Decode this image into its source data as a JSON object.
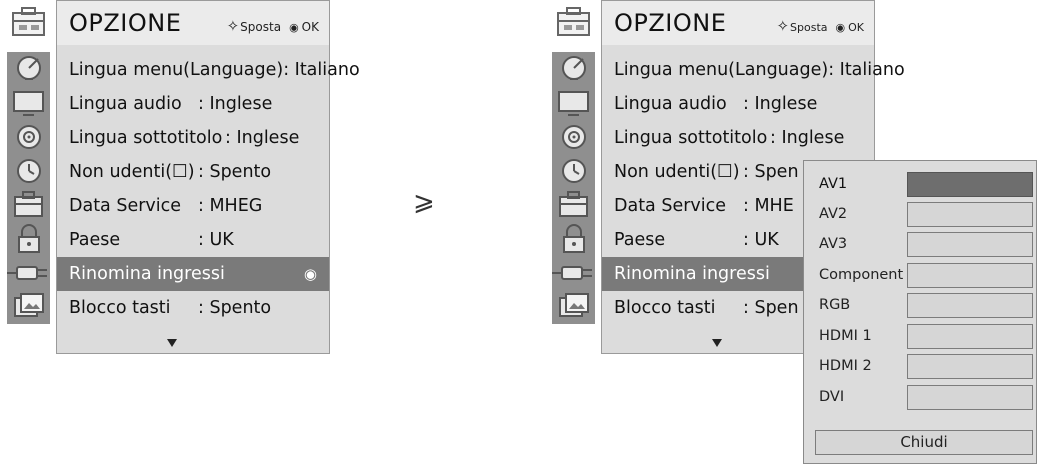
{
  "panel_left": {
    "title": "OPZIONE",
    "hint_move": "Sposta",
    "hint_ok": "OK",
    "items": [
      {
        "label": "Lingua menu(Language): Italiano",
        "value": ""
      },
      {
        "label": "Lingua audio",
        "value": ": Inglese"
      },
      {
        "label": "Lingua sottotitolo",
        "value": ": Inglese"
      },
      {
        "label": "Non udenti(☐)",
        "value": ": Spento"
      },
      {
        "label": "Data Service",
        "value": ": MHEG"
      },
      {
        "label": "Paese",
        "value": ": UK"
      },
      {
        "label": "Rinomina ingressi",
        "value": ""
      },
      {
        "label": "Blocco tasti",
        "value": ": Spento"
      }
    ]
  },
  "panel_right": {
    "title": "OPZIONE",
    "hint_move": "Sposta",
    "hint_ok": "OK",
    "items": [
      {
        "label": "Lingua menu(Language): Italiano",
        "value": ""
      },
      {
        "label": "Lingua audio",
        "value": ": Inglese"
      },
      {
        "label": "Lingua sottotitolo",
        "value": ": Inglese"
      },
      {
        "label": "Non udenti(☐)",
        "value": ": Spen"
      },
      {
        "label": "Data Service",
        "value": ": MHE"
      },
      {
        "label": "Paese",
        "value": ": UK"
      },
      {
        "label": "Rinomina ingressi",
        "value": ""
      },
      {
        "label": "Blocco tasti",
        "value": ": Spen"
      }
    ]
  },
  "transition_arrow": "⩾",
  "rename_popup": {
    "inputs": [
      "AV1",
      "AV2",
      "AV3",
      "Component",
      "RGB",
      "HDMI 1",
      "HDMI 2",
      "DVI"
    ],
    "close_label": "Chiudi"
  },
  "colors": {
    "menu_bg": "#dcdcdc",
    "selected_bg": "#7a7a7a",
    "popup_selected_box": "#6e6e6e"
  },
  "icons": [
    "antenna-dish-icon",
    "tv-picture-icon",
    "speaker-audio-icon",
    "clock-time-icon",
    "option-toolbox-icon",
    "lock-icon",
    "input-plug-icon",
    "photo-usb-icon"
  ]
}
